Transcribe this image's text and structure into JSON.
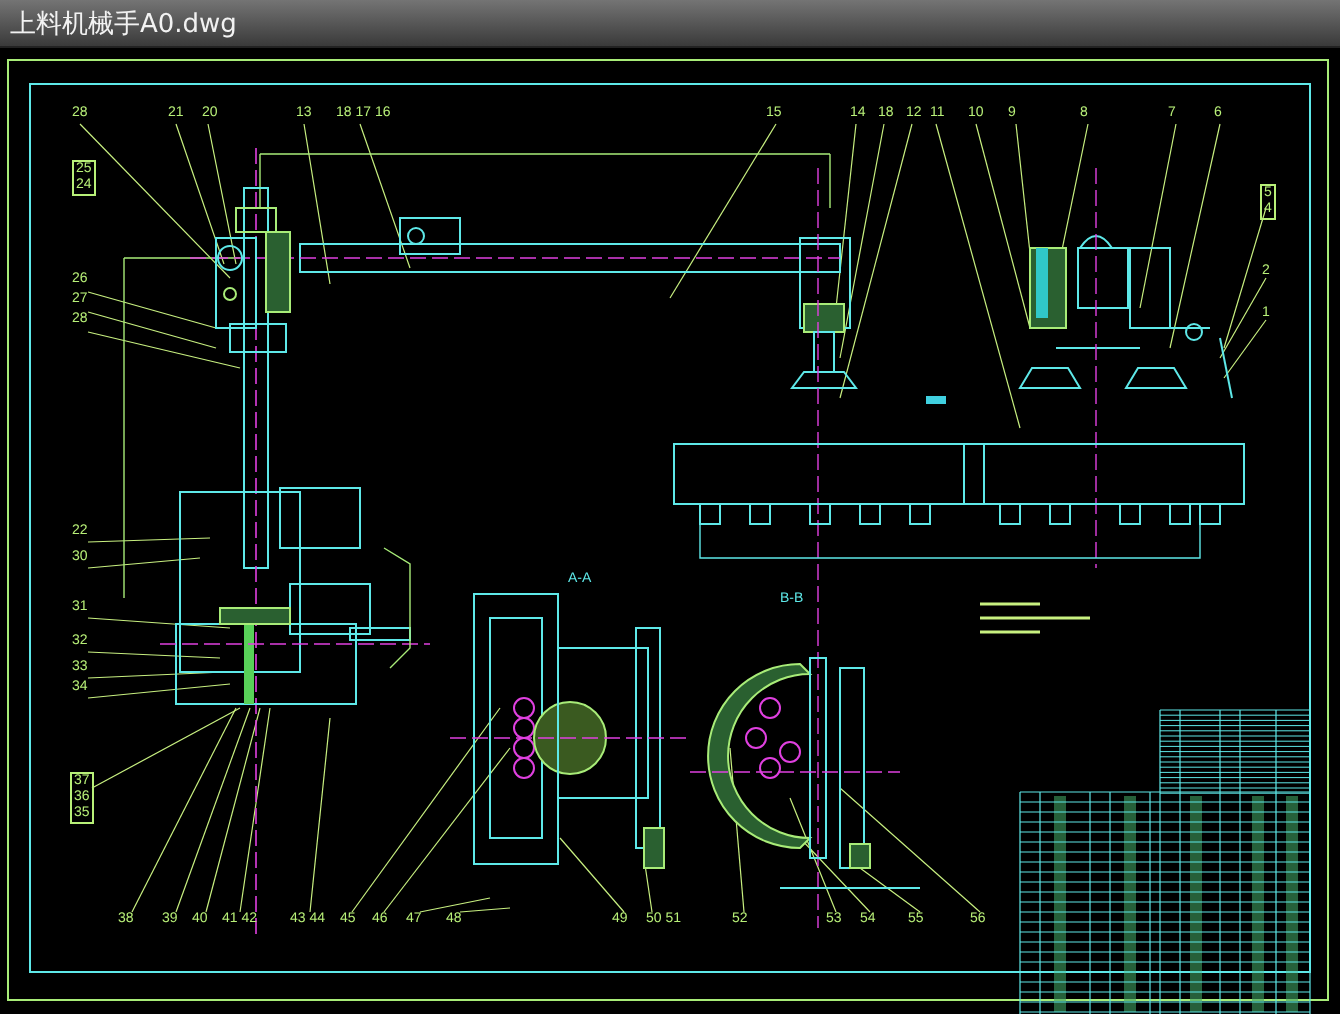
{
  "window": {
    "title": "上料机械手A0.dwg"
  },
  "drawing": {
    "labels": [
      {
        "kind": "plain",
        "text": "28"
      },
      {
        "kind": "plain",
        "text": "21"
      },
      {
        "kind": "plain",
        "text": "20"
      },
      {
        "kind": "plain",
        "text": "13"
      },
      {
        "kind": "plain",
        "text": "18 17 16"
      },
      {
        "kind": "plain",
        "text": "15"
      },
      {
        "kind": "plain",
        "text": "14"
      },
      {
        "kind": "plain",
        "text": "18"
      },
      {
        "kind": "plain",
        "text": "12"
      },
      {
        "kind": "plain",
        "text": "11"
      },
      {
        "kind": "plain",
        "text": "10"
      },
      {
        "kind": "plain",
        "text": "9"
      },
      {
        "kind": "plain",
        "text": "8"
      },
      {
        "kind": "plain",
        "text": "7"
      },
      {
        "kind": "plain",
        "text": "6"
      },
      {
        "kind": "boxed",
        "lines": [
          "25",
          "24"
        ]
      },
      {
        "kind": "plain",
        "text": "26"
      },
      {
        "kind": "plain",
        "text": "27"
      },
      {
        "kind": "plain",
        "text": "28"
      },
      {
        "kind": "plain",
        "text": "22"
      },
      {
        "kind": "plain",
        "text": "30"
      },
      {
        "kind": "plain",
        "text": "31"
      },
      {
        "kind": "plain",
        "text": "32"
      },
      {
        "kind": "plain",
        "text": "33"
      },
      {
        "kind": "plain",
        "text": "34"
      },
      {
        "kind": "boxed",
        "lines": [
          "37",
          "36",
          "35"
        ]
      },
      {
        "kind": "plain",
        "text": "38"
      },
      {
        "kind": "plain",
        "text": "39"
      },
      {
        "kind": "plain",
        "text": "40"
      },
      {
        "kind": "plain",
        "text": "41 42"
      },
      {
        "kind": "plain",
        "text": "43 44"
      },
      {
        "kind": "plain",
        "text": "45"
      },
      {
        "kind": "plain",
        "text": "46"
      },
      {
        "kind": "plain",
        "text": "47"
      },
      {
        "kind": "plain",
        "text": "48"
      },
      {
        "kind": "plain",
        "text": "49"
      },
      {
        "kind": "plain",
        "text": "50 51"
      },
      {
        "kind": "plain",
        "text": "52"
      },
      {
        "kind": "plain",
        "text": "53"
      },
      {
        "kind": "plain",
        "text": "54"
      },
      {
        "kind": "plain",
        "text": "55"
      },
      {
        "kind": "plain",
        "text": "56"
      },
      {
        "kind": "boxed",
        "lines": [
          "5",
          "4"
        ]
      },
      {
        "kind": "plain",
        "text": "2"
      },
      {
        "kind": "plain",
        "text": "1"
      },
      {
        "kind": "section",
        "text": "A-A"
      },
      {
        "kind": "section",
        "text": "B-B"
      }
    ]
  }
}
